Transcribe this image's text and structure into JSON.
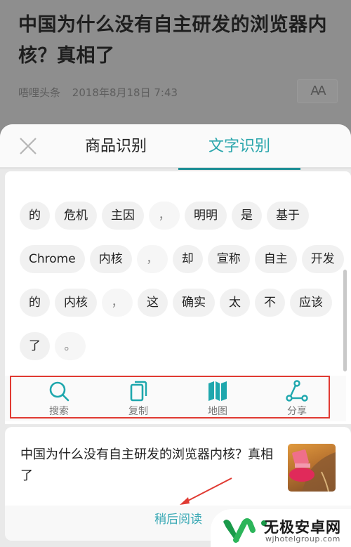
{
  "article": {
    "title": "中国为什么没有自主研发的浏览器内核？真相了",
    "source": "唔哩头条",
    "date": "2018年8月18日 7:43",
    "font_button_label": "AA"
  },
  "sheet": {
    "close_icon": "close-icon",
    "tabs": [
      {
        "label": "商品识别",
        "active": false
      },
      {
        "label": "文字识别",
        "active": true
      }
    ],
    "accent_color": "#2aa6ac",
    "word_rows": [
      [
        "的",
        "危机",
        "主因",
        "，",
        "明明",
        "是",
        "基于"
      ],
      [
        "Chrome",
        "内核",
        "，",
        "却",
        "宣称",
        "自主",
        "开发"
      ],
      [
        "的",
        "内核",
        "，",
        "这",
        "确实",
        "太",
        "不",
        "应该"
      ],
      [
        "了",
        "。"
      ]
    ],
    "actions": [
      {
        "label": "搜索",
        "icon": "search-icon"
      },
      {
        "label": "复制",
        "icon": "copy-icon"
      },
      {
        "label": "地图",
        "icon": "map-icon"
      },
      {
        "label": "分享",
        "icon": "share-icon"
      }
    ]
  },
  "card": {
    "title": "中国为什么没有自主研发的浏览器内核？真相了",
    "read_later_label": "稍后阅读"
  },
  "watermark": {
    "name": "无极安卓网",
    "url": "wjhotelgroup.com"
  }
}
